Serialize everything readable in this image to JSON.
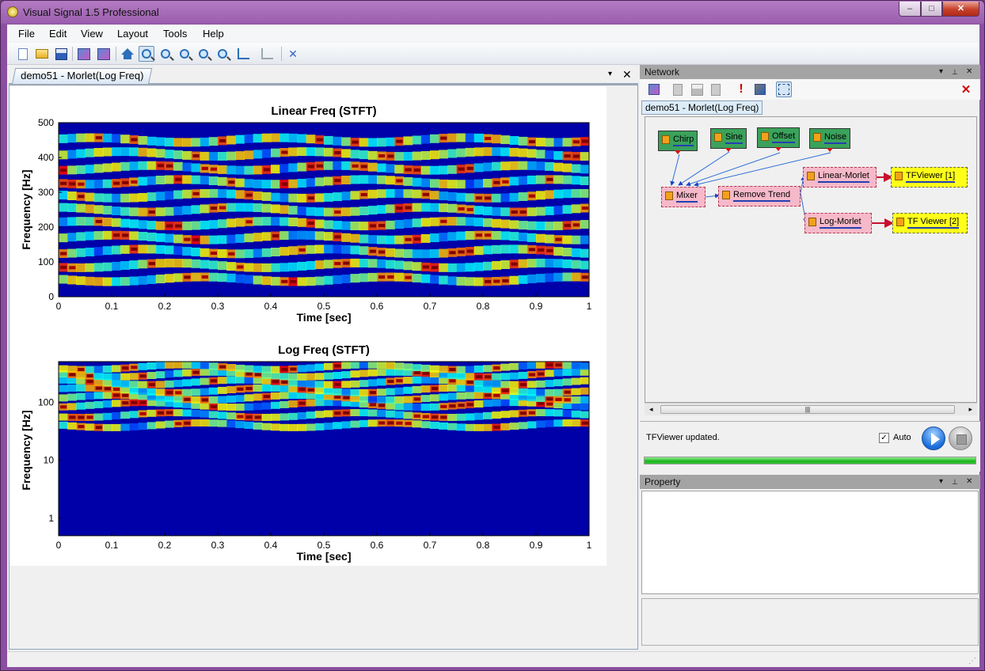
{
  "window": {
    "title": "Visual Signal 1.5 Professional",
    "buttons": {
      "minimize": "–",
      "maximize": "□",
      "close": "✕"
    }
  },
  "menu": [
    "File",
    "Edit",
    "View",
    "Layout",
    "Tools",
    "Help"
  ],
  "toolbar": [
    {
      "name": "new-file-icon",
      "active": false
    },
    {
      "name": "open-folder-icon",
      "active": false
    },
    {
      "name": "save-disk-icon",
      "active": false
    },
    {
      "name": "copy-image-icon",
      "active": false
    },
    {
      "name": "save-image-icon",
      "active": false
    },
    {
      "name": "home-view-icon",
      "active": false
    },
    {
      "name": "zoom-region-icon",
      "active": true
    },
    {
      "name": "zoom-in-icon",
      "active": false
    },
    {
      "name": "zoom-out-icon",
      "active": false
    },
    {
      "name": "zoom-fit-icon",
      "active": false
    },
    {
      "name": "zoom-x-icon",
      "active": false
    },
    {
      "name": "axis-scale-icon",
      "active": false
    },
    {
      "name": "axis-scale-menu-icon",
      "active": false
    },
    {
      "name": "tools-settings-icon",
      "active": false
    }
  ],
  "document": {
    "tab_label": "demo51 - Morlet(Log Freq)",
    "tab_menu": "▾",
    "tab_close": "✕"
  },
  "chart_data": [
    {
      "type": "heatmap",
      "title": "Linear Freq (STFT)",
      "xlabel": "Time [sec]",
      "ylabel": "Frequency [Hz]",
      "xlim": [
        0,
        1
      ],
      "ylim": [
        0,
        500
      ],
      "x_ticks": [
        "0",
        "0.1",
        "0.2",
        "0.3",
        "0.4",
        "0.5",
        "0.6",
        "0.7",
        "0.8",
        "0.9",
        "1"
      ],
      "y_ticks": [
        "0",
        "100",
        "200",
        "300",
        "400",
        "500"
      ],
      "colormap": "jet",
      "ridges_hz": [
        50,
        90,
        130,
        170,
        210,
        250,
        290,
        330,
        370,
        410,
        450
      ]
    },
    {
      "type": "heatmap",
      "title": "Log Freq (STFT)",
      "xlabel": "Time [sec]",
      "ylabel": "Frequency [Hz]",
      "xlim": [
        0,
        1
      ],
      "ylim": [
        0.5,
        500
      ],
      "y_scale": "log",
      "x_ticks": [
        "0",
        "0.1",
        "0.2",
        "0.3",
        "0.4",
        "0.5",
        "0.6",
        "0.7",
        "0.8",
        "0.9",
        "1"
      ],
      "y_ticks": [
        "1",
        "10",
        "100"
      ],
      "colormap": "jet",
      "ridges_hz": [
        40,
        60,
        90,
        120,
        160,
        220,
        300,
        400
      ]
    }
  ],
  "network": {
    "title": "Network",
    "pin": "📌",
    "menu": "▾",
    "close": "✕",
    "tab_label": "demo51 - Morlet(Log Freq)",
    "tools": [
      "add-module-icon",
      "copy-module-icon",
      "save-module-icon",
      "paste-module-icon",
      "warning-icon",
      "export-icon",
      "select-region-icon"
    ],
    "delete_icon": "✕",
    "nodes": [
      {
        "id": "chirp",
        "label": "Chirp",
        "kind": "src"
      },
      {
        "id": "sine",
        "label": "Sine",
        "kind": "src"
      },
      {
        "id": "offset",
        "label": "Offset",
        "kind": "src"
      },
      {
        "id": "noise",
        "label": "Noise",
        "kind": "src"
      },
      {
        "id": "mixer",
        "label": "Mixer",
        "kind": "proc"
      },
      {
        "id": "remove-trend",
        "label": "Remove Trend",
        "kind": "proc"
      },
      {
        "id": "linear-morlet",
        "label": "Linear-Morlet",
        "kind": "proc"
      },
      {
        "id": "log-morlet",
        "label": "Log-Morlet",
        "kind": "proc"
      },
      {
        "id": "tfviewer-1",
        "label": "TFViewer [1]",
        "kind": "view"
      },
      {
        "id": "tfviewer-2",
        "label": "TF Viewer [2]",
        "kind": "view"
      }
    ],
    "scroll": {
      "left": "◂",
      "right": "▸",
      "thumb": "|||"
    }
  },
  "run": {
    "status": "TFViewer updated.",
    "auto_label": "Auto",
    "auto_checked": true,
    "check_mark": "✓",
    "progress": 1.0
  },
  "property": {
    "title": "Property",
    "pin": "📌",
    "menu": "▾",
    "close": "✕"
  },
  "statusbar": {
    "grip": "⋰"
  }
}
